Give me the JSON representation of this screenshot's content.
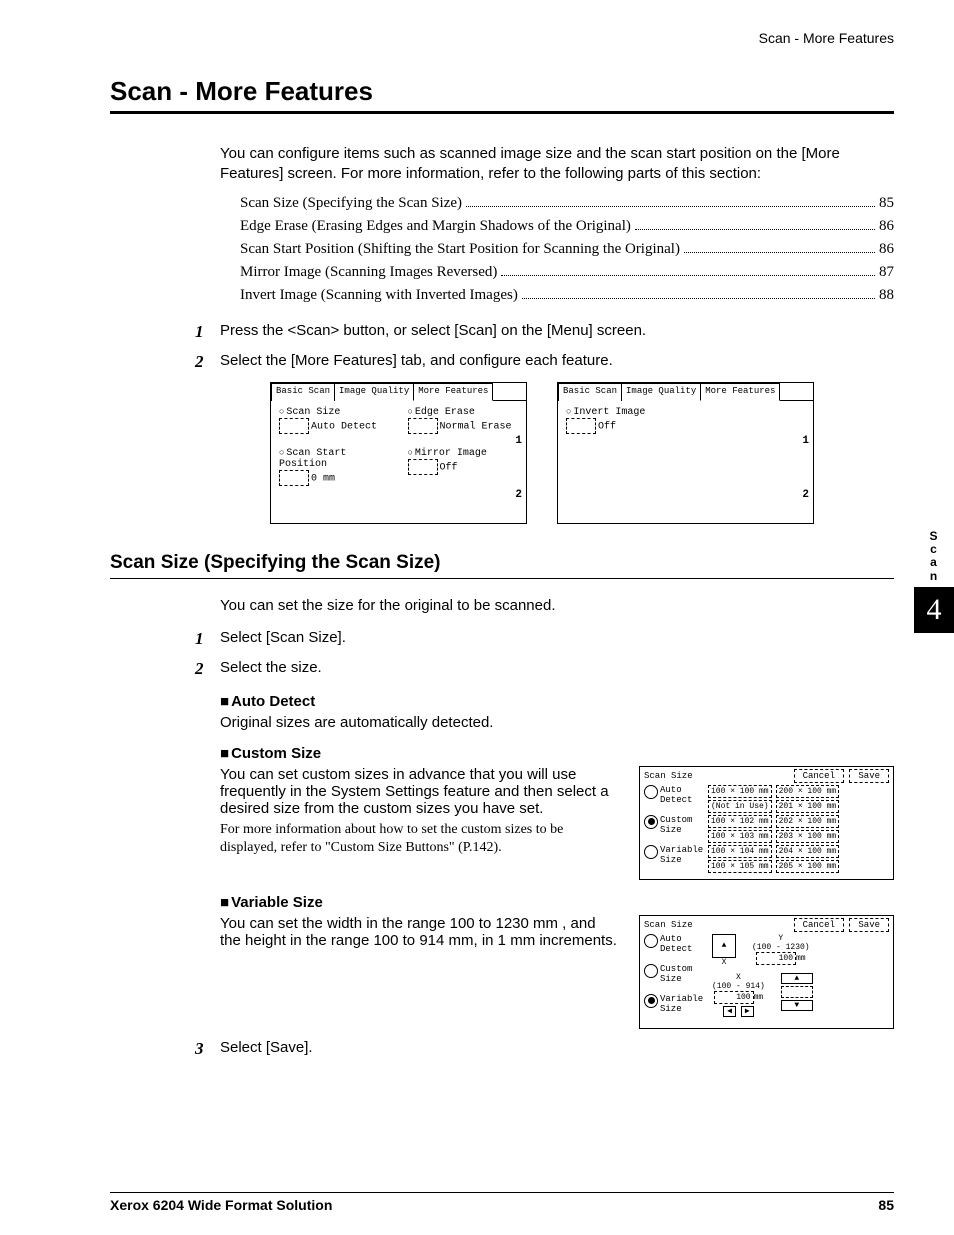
{
  "header": {
    "running_head": "Scan - More Features"
  },
  "title": "Scan - More Features",
  "intro": "You can configure items such as scanned image size and the scan start position on the [More Features] screen. For more information, refer to the following parts of this section:",
  "toc": [
    {
      "label": "Scan Size (Specifying the Scan Size)",
      "page": "85"
    },
    {
      "label": "Edge Erase (Erasing Edges and Margin Shadows of the Original)",
      "page": "86"
    },
    {
      "label": "Scan Start Position (Shifting the Start Position for Scanning the Original)",
      "page": "86"
    },
    {
      "label": "Mirror Image (Scanning Images Reversed)",
      "page": "87"
    },
    {
      "label": "Invert Image (Scanning with Inverted Images)",
      "page": "88"
    }
  ],
  "main_steps": [
    "Press the <Scan> button, or select [Scan] on the [Menu] screen.",
    "Select the [More Features] tab, and configure each feature."
  ],
  "panel_tabs": {
    "basic": "Basic Scan",
    "quality": "Image Quality",
    "more": "More Features"
  },
  "panel1": {
    "scan_size_label": "Scan Size",
    "scan_size_value": "Auto Detect",
    "edge_erase_label": "Edge Erase",
    "edge_erase_value": "Normal Erase",
    "start_pos_label": "Scan Start Position",
    "start_pos_value": "0 mm",
    "mirror_label": "Mirror Image",
    "mirror_value": "Off",
    "num1": "1",
    "num2": "2"
  },
  "panel2": {
    "invert_label": "Invert Image",
    "invert_value": "Off",
    "num1": "1",
    "num2": "2"
  },
  "sidebar": {
    "label": "Scan",
    "chapter": "4"
  },
  "section2": {
    "title": "Scan Size (Specifying the Scan Size)",
    "intro": "You can set the size for the original to be scanned.",
    "steps": [
      "Select [Scan Size].",
      "Select the size."
    ],
    "auto_detect": {
      "heading": "Auto Detect",
      "text": "Original sizes are automatically detected."
    },
    "custom_size": {
      "heading": "Custom Size",
      "text": "You can set custom sizes in advance that you will use frequently in the System Settings feature and then select a desired size from the custom sizes you have set.",
      "note": "For more information about how to set the custom sizes to be displayed, refer to \"Custom Size Buttons\" (P.142)."
    },
    "variable_size": {
      "heading": "Variable Size",
      "text": "You can set the width in the range 100 to 1230 mm , and the height in the range 100 to 914 mm, in 1 mm increments."
    },
    "step3": "Select [Save]."
  },
  "custom_panel": {
    "title": "Scan Size",
    "cancel": "Cancel",
    "save": "Save",
    "radios": [
      "Auto\nDetect",
      "Custom\nSize",
      "Variable\nSize"
    ],
    "col1": [
      "100 × 100 mm",
      "(Not in Use)",
      "100 × 102 mm",
      "100 × 103 mm",
      "100 × 104 mm",
      "100 × 105 mm"
    ],
    "col2": [
      "200 × 100 mm",
      "201 × 100 mm",
      "202 × 100 mm",
      "203 × 100 mm",
      "204 × 100 mm",
      "205 × 100 mm"
    ]
  },
  "variable_panel": {
    "title": "Scan Size",
    "cancel": "Cancel",
    "save": "Save",
    "radios": [
      "Auto\nDetect",
      "Custom\nSize",
      "Variable\nSize"
    ],
    "y_label": "Y",
    "y_range": "(100 - 1230)",
    "y_value": "100",
    "y_unit": "mm",
    "x_label": "X",
    "x_range": "(100 - 914)",
    "x_value": "100",
    "x_unit": "mm"
  },
  "footer": {
    "product": "Xerox 6204 Wide Format Solution",
    "page": "85"
  }
}
